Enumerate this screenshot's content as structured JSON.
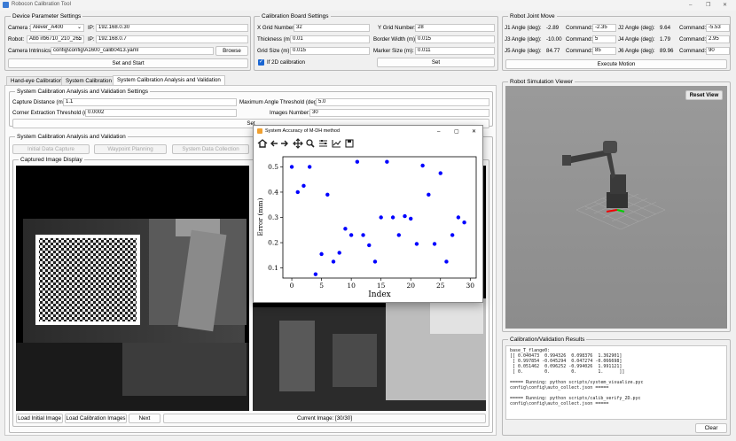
{
  "window": {
    "title": "Robocon Calibration Tool",
    "controls": [
      "–",
      "❐",
      "✕"
    ]
  },
  "device": {
    "group_title": "Device Parameter Settings",
    "camera_label": "Camera :",
    "camera_value": "Alever_A400",
    "camera_ip_label": "IP:",
    "camera_ip": "192.168.0.30",
    "robot_label": "Robot:",
    "robot_value": "Abb irb6710_210_265",
    "robot_ip_label": "IP:",
    "robot_ip": "192.168.0.7",
    "intrinsics_label": "Camera Intrinsics:",
    "intrinsics_value": "config\\config\\A1600_calib0413.yaml",
    "browse": "Browse",
    "set_start": "Set and Start"
  },
  "board": {
    "group_title": "Calibration Board Settings",
    "xgrid_label": "X Grid Number:",
    "xgrid": "32",
    "ygrid_label": "Y Grid Number:",
    "ygrid": "28",
    "thickness_label": "Thickness (m):",
    "thickness": "0.01",
    "border_label": "Border Width (m):",
    "border": "0.015",
    "gridsize_label": "Grid Size (m):",
    "gridsize": "0.015",
    "marker_label": "Marker Size (m):",
    "marker": "0.011",
    "if2d_label": "If 2D calibration",
    "set": "Set"
  },
  "joints": {
    "group_title": "Robot Joint Move",
    "rows": [
      [
        {
          "label": "J1 Angle (deg):",
          "value": "-2.89",
          "cmd": "-2.35"
        },
        {
          "label": "J2 Angle (deg):",
          "value": "9.64",
          "cmd": "-5.53"
        }
      ],
      [
        {
          "label": "J3 Angle (deg):",
          "value": "-10.00",
          "cmd": "5"
        },
        {
          "label": "J4 Angle (deg):",
          "value": "1.79",
          "cmd": "2.95"
        }
      ],
      [
        {
          "label": "J5 Angle (deg):",
          "value": "84.77",
          "cmd": "85"
        },
        {
          "label": "J6 Angle (deg):",
          "value": "89.96",
          "cmd": "90"
        }
      ]
    ],
    "command_label": "Command:",
    "execute": "Execute Motion"
  },
  "tabs": [
    "Hand-eye Calibration",
    "System Calibration",
    "System Calibration Analysis and Validation"
  ],
  "analysis_settings": {
    "group_title": "System Calibration Analysis and Validation Settings",
    "capture_label": "Capture Distance (m):",
    "capture": "1.1",
    "maxangle_label": "Maximum Angle Threshold (deg):",
    "maxangle": "5.0",
    "corner_label": "Corner Extraction Threshold (m):",
    "corner": "0.0002",
    "images_label": "Images Number:",
    "images": "30",
    "set": "Set"
  },
  "analysis": {
    "group_title": "System Calibration Analysis and Validation",
    "buttons": [
      "Initial Data Capture",
      "Waypoint Planning",
      "System Data Collection"
    ],
    "captured_title": "Captured Image Display",
    "load_initial": "Load Initial Image",
    "load_calib": "Load Calibration Images",
    "next": "Next",
    "current_image": "Current Image: [30/30]"
  },
  "sim": {
    "group_title": "Robot Simulation Viewer",
    "reset": "Reset View"
  },
  "results": {
    "group_title": "Calibration/Validation Results",
    "log": [
      "base_T_flange0:",
      "[[ 0.040473  0.994326  0.098376  1.362901]",
      " [ 0.997854 -0.045294  0.047274 -0.066698]",
      " [ 0.051462  0.096252 -0.994026  1.991121]",
      " [ 0.        0.        0.        1.      ]]",
      "",
      "===== Running: python scripts/system_visualize.pyc",
      "config\\config\\auto_collect.json =====",
      "",
      "===== Running: python scripts/calib_verify_2D.pyc",
      "config\\config\\auto_collect.json ====="
    ],
    "clear": "Clear"
  },
  "plot_window": {
    "title": "System Accuracy of M-DH method",
    "toolbar": [
      "home-icon",
      "back-icon",
      "forward-icon",
      "pan-icon",
      "zoom-icon",
      "configure-icon",
      "edit-axes-icon",
      "save-icon"
    ],
    "controls": [
      "–",
      "▢",
      "✕"
    ]
  },
  "chart_data": {
    "type": "scatter",
    "title": "",
    "xlabel": "Index",
    "ylabel": "Error (mm)",
    "xlim": [
      -1.5,
      31
    ],
    "ylim": [
      0.06,
      0.54
    ],
    "xticks": [
      0,
      5,
      10,
      15,
      20,
      25,
      30
    ],
    "yticks": [
      0.1,
      0.2,
      0.3,
      0.4,
      0.5
    ],
    "color": "#0000ff",
    "x": [
      0,
      1,
      2,
      3,
      4,
      5,
      6,
      7,
      8,
      9,
      10,
      11,
      12,
      13,
      14,
      15,
      16,
      17,
      18,
      19,
      20,
      21,
      22,
      23,
      24,
      25,
      26,
      27,
      28,
      29
    ],
    "y": [
      0.5,
      0.4,
      0.425,
      0.5,
      0.075,
      0.155,
      0.39,
      0.125,
      0.16,
      0.255,
      0.23,
      0.52,
      0.23,
      0.19,
      0.125,
      0.3,
      0.52,
      0.3,
      0.23,
      0.305,
      0.295,
      0.195,
      0.505,
      0.39,
      0.195,
      0.475,
      0.125,
      0.23,
      0.3,
      0.28
    ]
  }
}
